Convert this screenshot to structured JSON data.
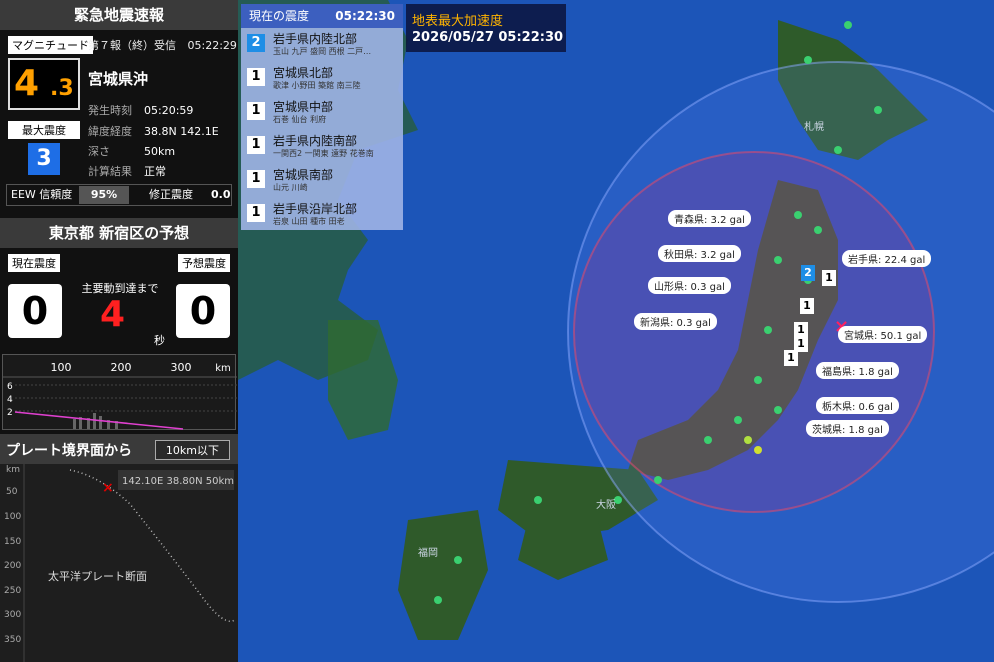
{
  "eew": {
    "title": "緊急地震速報",
    "magnitude_label": "マグニチュード",
    "report": "第７報（終）受信",
    "report_time": "05:22:29",
    "magnitude_int": "4",
    "magnitude_dec": ".3",
    "epicenter": "宮城県沖",
    "max_intensity_label": "最大震度",
    "max_intensity": "3",
    "details": [
      {
        "k": "発生時刻",
        "v": "05:20:59"
      },
      {
        "k": "緯度経度",
        "v": "38.8N 142.1E"
      },
      {
        "k": "深さ",
        "v": "50km"
      },
      {
        "k": "計算結果",
        "v": "正常"
      }
    ],
    "confidence_label": "EEW 信頼度",
    "confidence": "95%",
    "corrected_label": "修正震度",
    "corrected": "0.0"
  },
  "forecast": {
    "title": "東京都 新宿区の予想",
    "current_label": "現在震度",
    "predicted_label": "予想震度",
    "current": "0",
    "predicted": "0",
    "arrival_label": "主要動到達まで",
    "arrival": "4",
    "arrival_unit": "秒"
  },
  "dist_chart": {
    "x_ticks": [
      "100",
      "200",
      "300"
    ],
    "x_unit": "km",
    "y_ticks": [
      "6",
      "4",
      "2"
    ]
  },
  "plate": {
    "title": "プレート境界面から",
    "button": "10km以下",
    "y_unit": "km",
    "y_ticks": [
      "50",
      "100",
      "150",
      "200",
      "250",
      "300",
      "350"
    ],
    "info": "142.10E 38.80N  50km",
    "section_label": "太平洋プレート断面"
  },
  "intensity_list": {
    "title": "現在の震度",
    "time": "05:22:30",
    "rows": [
      {
        "intensity": "2",
        "region": "岩手県内陸北部",
        "cities": "玉山 九戸 盛岡 西根 二戸…"
      },
      {
        "intensity": "1",
        "region": "宮城県北部",
        "cities": "歌津 小野田 築館 南三陸"
      },
      {
        "intensity": "1",
        "region": "宮城県中部",
        "cities": "石巻 仙台 利府"
      },
      {
        "intensity": "1",
        "region": "岩手県内陸南部",
        "cities": "一関西2 一関東 遠野 花巻南"
      },
      {
        "intensity": "1",
        "region": "宮城県南部",
        "cities": "山元 川崎"
      },
      {
        "intensity": "1",
        "region": "岩手県沿岸北部",
        "cities": "岩泉 山田 種市 田老"
      }
    ]
  },
  "pga": {
    "title": "地表最大加速度",
    "time": "2026/05/27 05:22:30"
  },
  "gal_labels": [
    {
      "text": "青森県: 3.2 gal"
    },
    {
      "text": "秋田県: 3.2 gal"
    },
    {
      "text": "山形県: 0.3 gal"
    },
    {
      "text": "新潟県: 0.3 gal"
    },
    {
      "text": "岩手県: 22.4 gal"
    },
    {
      "text": "宮城県: 50.1 gal"
    },
    {
      "text": "福島県: 1.8 gal"
    },
    {
      "text": "栃木県: 0.6 gal"
    },
    {
      "text": "茨城県: 1.8 gal"
    }
  ],
  "map_cities": [
    "札幌",
    "大阪",
    "福岡"
  ],
  "colors": {
    "magnitude": "#ffa000",
    "intensity3": "#1e6ee6",
    "arrival": "#ff2020",
    "sea": "#1c55b8",
    "land": "#2f5a2a"
  }
}
